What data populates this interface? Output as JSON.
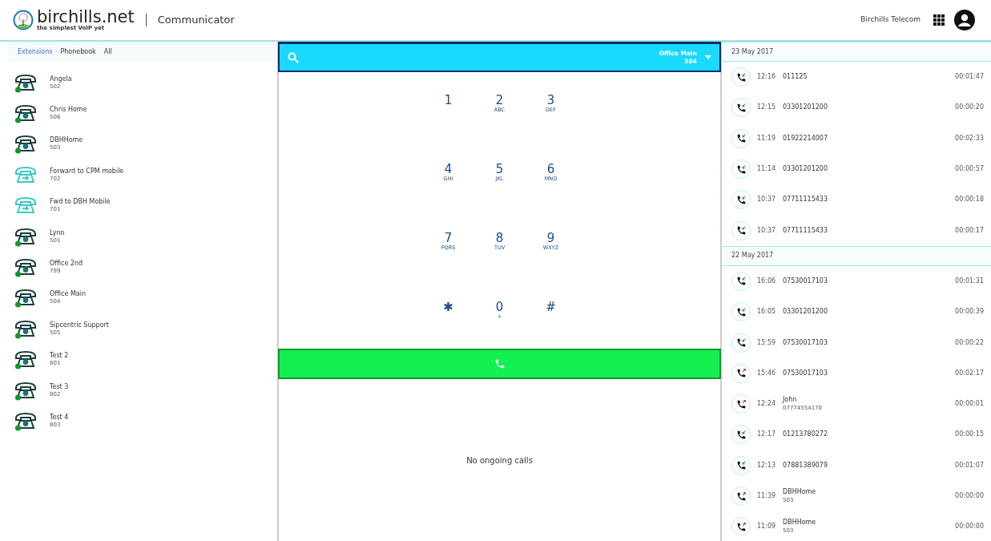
{
  "header": {
    "logo_name": "birchills.net",
    "logo_tagline": "the simplest VoIP yet",
    "app_title": "Communicator",
    "account": "Birchills Telecom"
  },
  "contact_tabs": [
    {
      "label": "Extensions",
      "selected": true
    },
    {
      "label": "Phonebook",
      "selected": false
    },
    {
      "label": "All",
      "selected": false
    }
  ],
  "contacts": [
    {
      "name": "Angela",
      "number": "502",
      "kind": "phone",
      "online": true
    },
    {
      "name": "Chris Home",
      "number": "506",
      "kind": "phone",
      "online": true
    },
    {
      "name": "DBHHome",
      "number": "503",
      "kind": "phone",
      "online": true
    },
    {
      "name": "Forward to CPM mobile",
      "number": "702",
      "kind": "forward",
      "online": false
    },
    {
      "name": "Fwd to DBH Mobile",
      "number": "701",
      "kind": "forward",
      "online": false
    },
    {
      "name": "Lynn",
      "number": "501",
      "kind": "phone",
      "online": true
    },
    {
      "name": "Office 2nd",
      "number": "799",
      "kind": "phone",
      "online": true
    },
    {
      "name": "Office Main",
      "number": "504",
      "kind": "phone",
      "online": true
    },
    {
      "name": "Sipcentric Support",
      "number": "505",
      "kind": "phone",
      "online": true
    },
    {
      "name": "Test 2",
      "number": "801",
      "kind": "phone",
      "online": true
    },
    {
      "name": "Test 3",
      "number": "802",
      "kind": "phone",
      "online": true
    },
    {
      "name": "Test 4",
      "number": "803",
      "kind": "phone",
      "online": true
    }
  ],
  "dialer": {
    "line_name": "Office Main",
    "line_number": "504",
    "keys": [
      {
        "digit": "1"
      },
      {
        "digit": "2",
        "letters": "ABC"
      },
      {
        "digit": "3",
        "letters": "DEF"
      },
      {
        "digit": "4",
        "letters": "GHI"
      },
      {
        "digit": "5",
        "letters": "JKL"
      },
      {
        "digit": "6",
        "letters": "MNO"
      },
      {
        "digit": "7",
        "letters": "PQRS"
      },
      {
        "digit": "8",
        "letters": "TUV"
      },
      {
        "digit": "9",
        "letters": "WXYZ"
      },
      {
        "digit": "✱"
      },
      {
        "digit": "0",
        "letters": "+"
      },
      {
        "digit": "#"
      }
    ],
    "status": "No ongoing calls"
  },
  "call_history": [
    {
      "date": "23 May 2017",
      "calls": [
        {
          "kind": "incoming",
          "time": "12:16",
          "number": "011125",
          "duration": "00:01:47"
        },
        {
          "kind": "incoming",
          "time": "12:15",
          "number": "03301201200",
          "duration": "00:00:20"
        },
        {
          "kind": "incoming",
          "time": "11:19",
          "number": "01922214007",
          "duration": "00:02:33"
        },
        {
          "kind": "incoming",
          "time": "11:14",
          "number": "03301201200",
          "duration": "00:00:57"
        },
        {
          "kind": "incoming",
          "time": "10:37",
          "number": "07711115433",
          "duration": "00:00:18"
        },
        {
          "kind": "incoming",
          "time": "10:37",
          "number": "07711115433",
          "duration": "00:00:17"
        }
      ]
    },
    {
      "date": "22 May 2017",
      "calls": [
        {
          "kind": "incoming",
          "time": "16:06",
          "number": "07530017103",
          "duration": "00:01:31"
        },
        {
          "kind": "incoming",
          "time": "16:05",
          "number": "03301201200",
          "duration": "00:00:39"
        },
        {
          "kind": "incoming",
          "time": "15:59",
          "number": "07530017103",
          "duration": "00:00:22"
        },
        {
          "kind": "outgoing",
          "time": "15:46",
          "number": "07530017103",
          "duration": "00:02:17"
        },
        {
          "kind": "outgoing",
          "time": "12:24",
          "name": "John",
          "number": "07774554170",
          "duration": "00:00:01"
        },
        {
          "kind": "incoming",
          "time": "12:17",
          "number": "01213780272",
          "duration": "00:00:15"
        },
        {
          "kind": "incoming",
          "time": "12:13",
          "number": "07881389079",
          "duration": "00:01:07"
        },
        {
          "kind": "outgoing",
          "time": "11:39",
          "name": "DBHHome",
          "number": "503",
          "duration": "00:00:00"
        },
        {
          "kind": "outgoing",
          "time": "11:09",
          "name": "DBHHome",
          "number": "503",
          "duration": "00:00:00"
        }
      ]
    }
  ]
}
